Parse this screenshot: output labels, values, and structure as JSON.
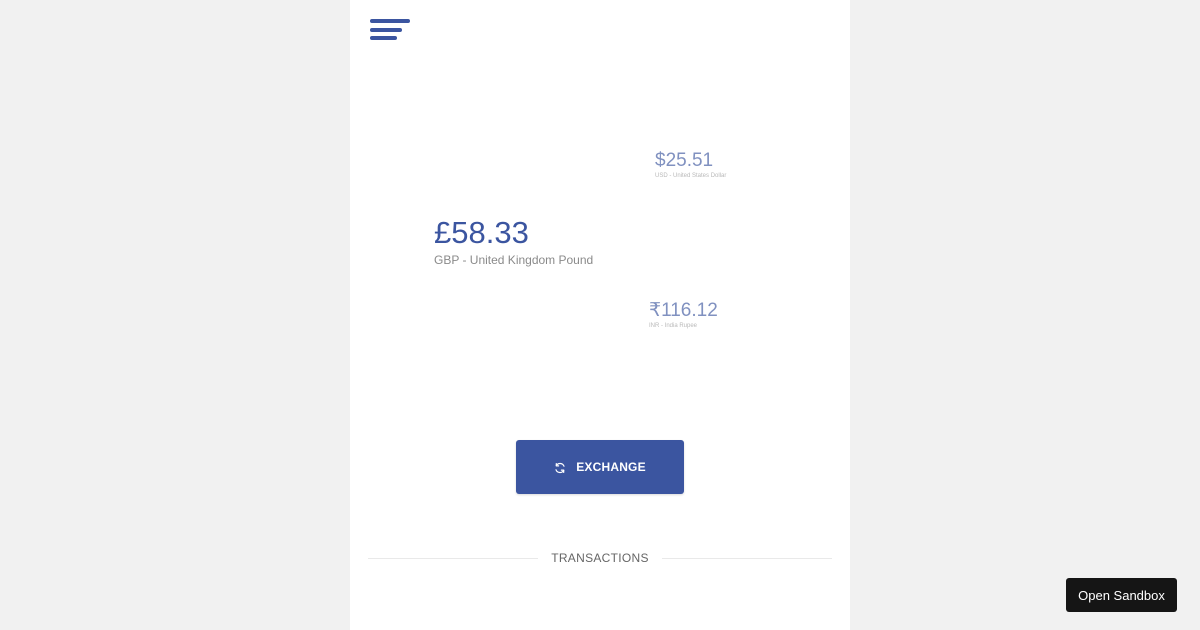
{
  "header": {
    "menu_icon": "hamburger-menu-icon"
  },
  "currencies": {
    "secondary_top": {
      "amount": "$25.51",
      "description": "USD - United States Dollar"
    },
    "primary": {
      "amount": "£58.33",
      "description": "GBP - United Kingdom Pound"
    },
    "secondary_bottom": {
      "amount": "₹116.12",
      "description": "INR - India Rupee"
    }
  },
  "exchange": {
    "label": "EXCHANGE",
    "icon": "refresh-icon"
  },
  "transactions": {
    "title": "TRANSACTIONS"
  },
  "sandbox": {
    "label": "Open Sandbox"
  },
  "colors": {
    "accent": "#3b55a0",
    "page_background": "#f1f1f1",
    "panel_background": "#ffffff",
    "sandbox_button": "#151515"
  }
}
